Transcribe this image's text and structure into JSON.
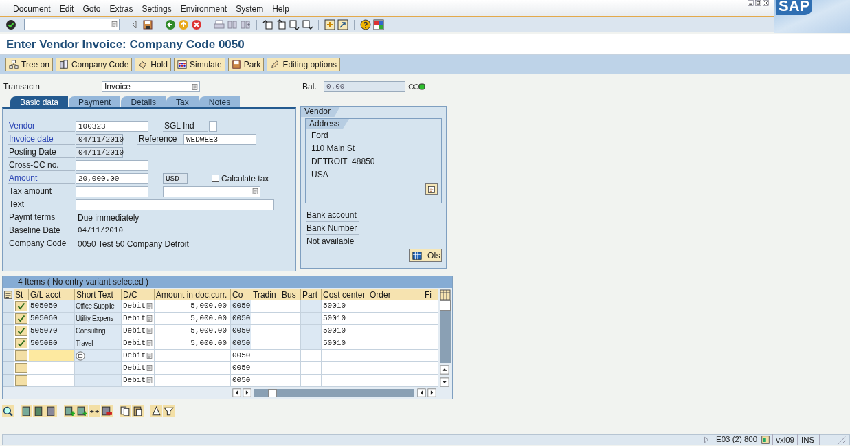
{
  "menu": [
    "Document",
    "Edit",
    "Goto",
    "Extras",
    "Settings",
    "Environment",
    "System",
    "Help"
  ],
  "logo": "SAP",
  "title": "Enter Vendor Invoice: Company Code 0050",
  "app_buttons": [
    "Tree on",
    "Company Code",
    "Hold",
    "Simulate",
    "Park",
    "Editing options"
  ],
  "transaction": {
    "label": "Transactn",
    "value": "Invoice"
  },
  "balance": {
    "label": "Bal.",
    "value": "0.00"
  },
  "tabs": [
    {
      "label": "Basic data",
      "selected": true
    },
    {
      "label": "Payment",
      "selected": false
    },
    {
      "label": "Details",
      "selected": false
    },
    {
      "label": "Tax",
      "selected": false
    },
    {
      "label": "Notes",
      "selected": false
    }
  ],
  "basic_data": {
    "rows": [
      {
        "label": "Vendor",
        "required": true,
        "kind": "input",
        "value": "100323",
        "side": [
          {
            "kind": "labeled_input",
            "label": "SGL Ind"
          }
        ]
      },
      {
        "label": "Invoice date",
        "required": true,
        "kind": "date",
        "value": "04/11/2010",
        "side": [
          {
            "kind": "labeled_input",
            "label": "Reference",
            "value": "WEDWEE3"
          }
        ]
      },
      {
        "label": "Posting Date",
        "required": false,
        "kind": "date",
        "value": "04/11/2010"
      },
      {
        "label": "Cross-CC no.",
        "required": false,
        "kind": "input"
      },
      {
        "label": "Amount",
        "required": true,
        "kind": "input",
        "value": "20,000.00",
        "side": [
          {
            "kind": "currency",
            "value": "USD"
          },
          {
            "kind": "checkbox",
            "label": "Calculate tax",
            "checked": false
          }
        ]
      },
      {
        "label": "Tax amount",
        "required": false,
        "kind": "input",
        "side": [
          {
            "kind": "dropdown"
          }
        ]
      },
      {
        "label": "Text",
        "required": false,
        "kind": "wide_input"
      },
      {
        "label": "Paymt terms",
        "required": false,
        "kind": "display",
        "value": "Due immediately"
      },
      {
        "label": "Baseline Date",
        "required": false,
        "kind": "output",
        "value": "04/11/2010"
      },
      {
        "label": "Company Code",
        "required": false,
        "kind": "display",
        "value": "0050 Test 50 Company Detroit"
      }
    ]
  },
  "vendor": {
    "title": "Vendor",
    "address": {
      "title": "Address",
      "lines": [
        "Ford",
        "110 Main St",
        "DETROIT  48850",
        "USA"
      ]
    },
    "bank_labels": [
      "Bank account",
      "Bank Number"
    ],
    "bank_value": "Not available",
    "button": "OIs"
  },
  "items": {
    "title": "4 Items ( No entry variant selected )",
    "columns": [
      "St",
      "G/L acct",
      "Short Text",
      "D/C",
      "Amount in doc.curr.",
      "Co",
      "Tradin",
      "Bus",
      "Part",
      "Cost center",
      "Order",
      "Fi"
    ],
    "rows": [
      {
        "checked": true,
        "focused": false,
        "gl_acct": "505050",
        "short_text": "Office Supplie",
        "dc": "Debit",
        "amount": "5,000.00",
        "co": "0050",
        "cost_center": "50010"
      },
      {
        "checked": true,
        "focused": false,
        "gl_acct": "505060",
        "short_text": "Utility Expens",
        "dc": "Debit",
        "amount": "5,000.00",
        "co": "0050",
        "cost_center": "50010"
      },
      {
        "checked": true,
        "focused": false,
        "gl_acct": "505070",
        "short_text": "Consulting",
        "dc": "Debit",
        "amount": "5,000.00",
        "co": "0050",
        "cost_center": "50010"
      },
      {
        "checked": true,
        "focused": false,
        "gl_acct": "505080",
        "short_text": "Travel",
        "dc": "Debit",
        "amount": "5,000.00",
        "co": "0050",
        "cost_center": "50010"
      },
      {
        "checked": false,
        "focused": true,
        "dc": "Debit",
        "co": "0050"
      },
      {
        "checked": false,
        "focused": false,
        "dc": "Debit",
        "co": "0050"
      },
      {
        "checked": false,
        "focused": false,
        "dc": "Debit",
        "co": "0050"
      }
    ]
  },
  "status_bar": {
    "system": "E03 (2) 800",
    "server": "vxl09",
    "mode": "INS"
  }
}
